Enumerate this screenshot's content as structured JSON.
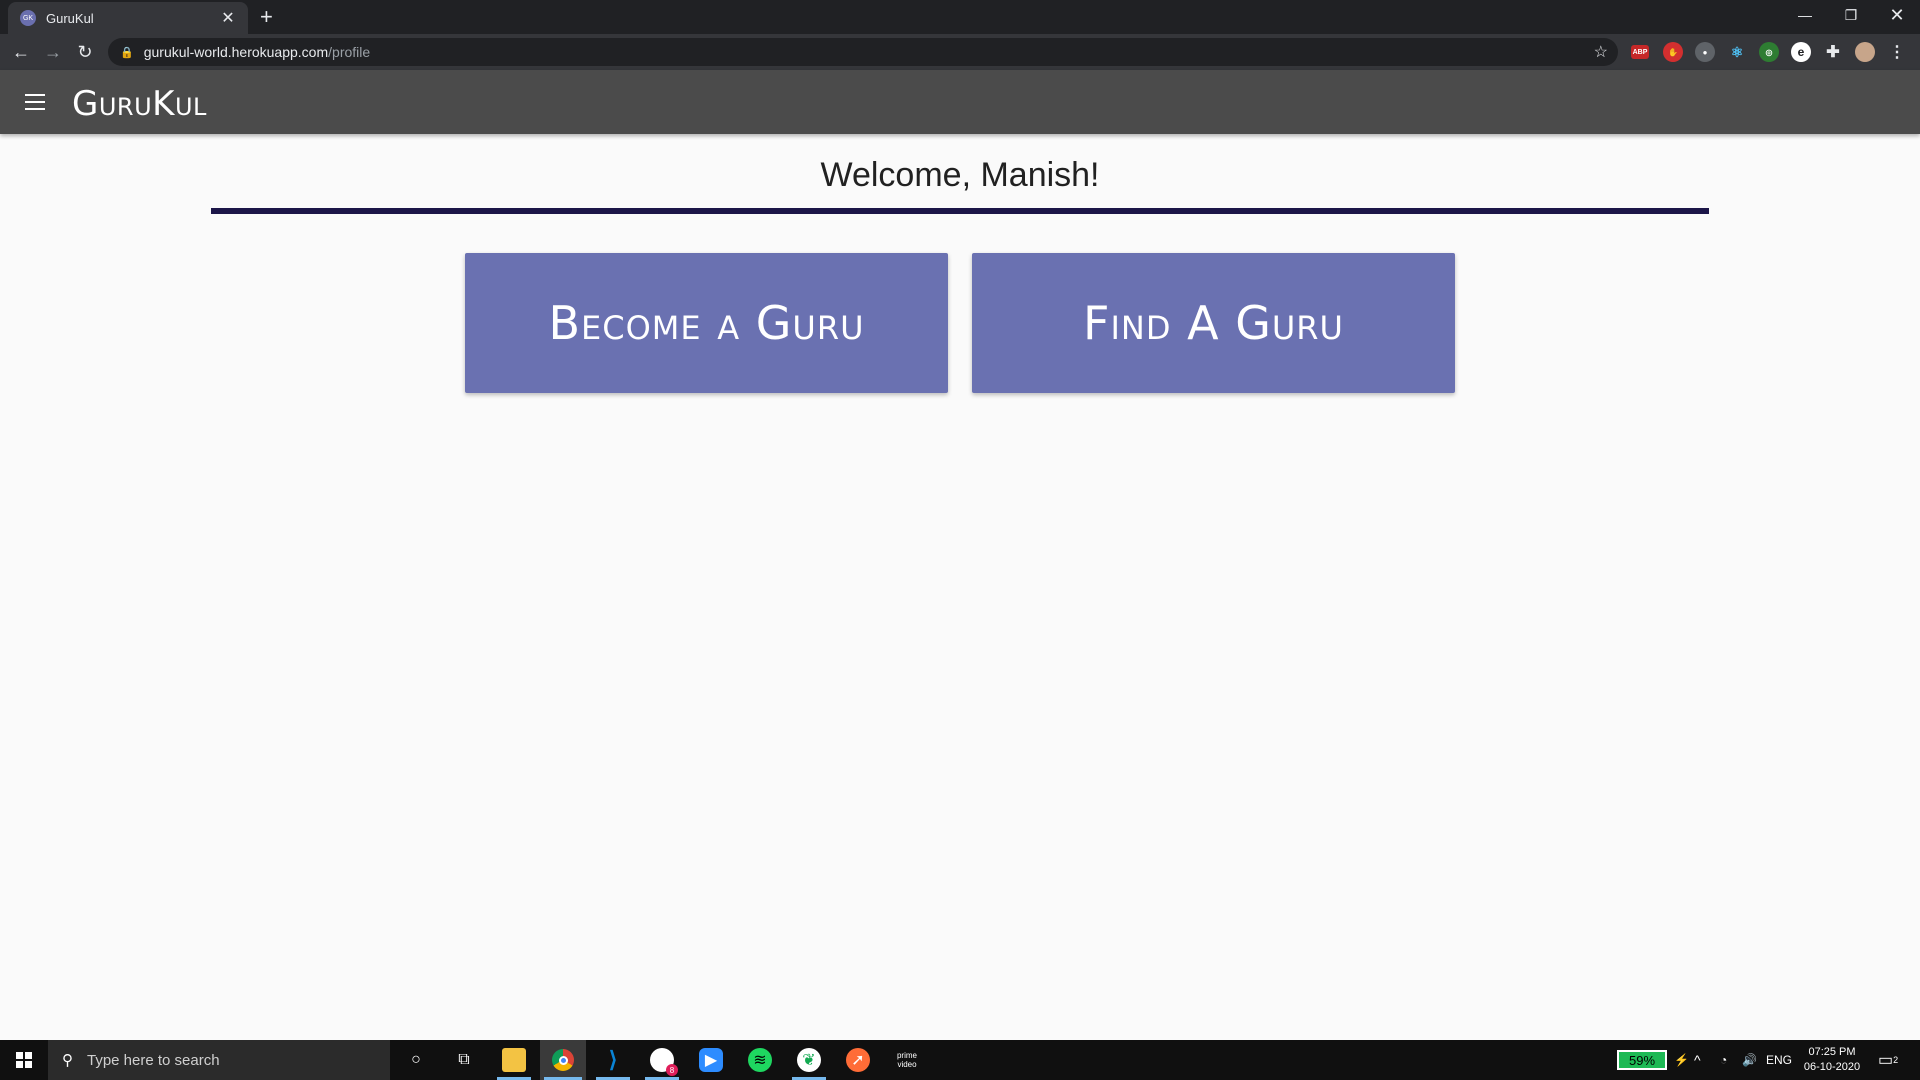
{
  "browser": {
    "tab_title": "GuruKul",
    "tab_favicon_text": "GK",
    "url_host": "gurukul-world.herokuapp.com",
    "url_path": "/profile"
  },
  "app": {
    "brand": "GuruKul",
    "welcome": "Welcome, Manish!",
    "actions": {
      "become": "Become a Guru",
      "find": "Find A Guru"
    },
    "colors": {
      "header_bg": "#4b4b4b",
      "divider": "#1c1648",
      "button_bg": "#6a71b1"
    }
  },
  "taskbar": {
    "search_placeholder": "Type here to search",
    "battery": "59%",
    "language": "ENG",
    "time": "07:25 PM",
    "date": "06-10-2020",
    "notification_count": "2",
    "prime_label": "prime video",
    "slack_badge": "8"
  }
}
